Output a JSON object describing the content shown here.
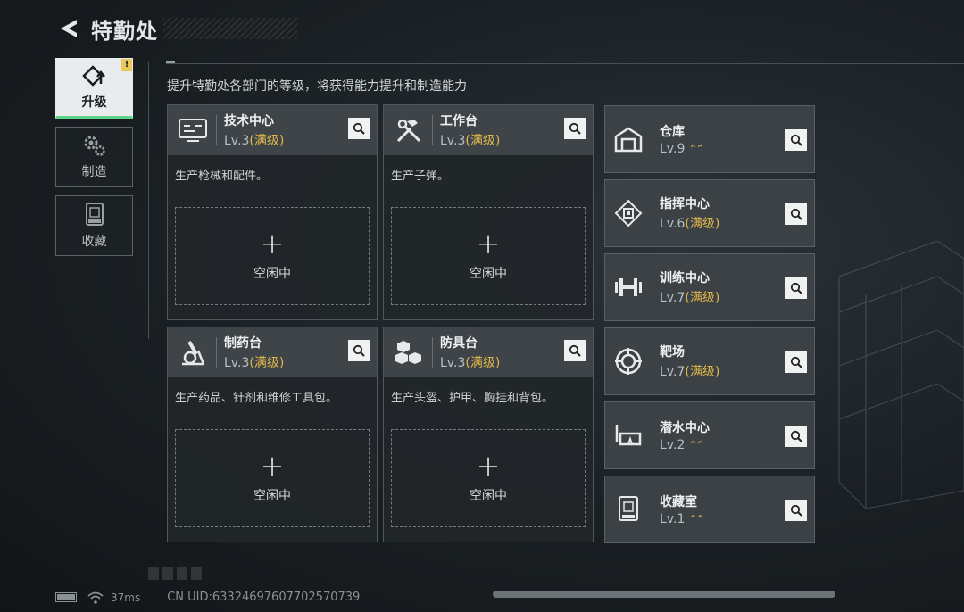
{
  "header": {
    "title": "特勤处"
  },
  "sidenav": [
    {
      "label": "升级",
      "icon": "upgrade-icon",
      "active": true,
      "badge": "!"
    },
    {
      "label": "制造",
      "icon": "gears-icon",
      "active": false
    },
    {
      "label": "收藏",
      "icon": "collection-icon",
      "active": false
    }
  ],
  "description": "提升特勤处各部门的等级，将获得能力提升和制造能力",
  "cards": [
    {
      "name": "技术中心",
      "level": "Lv.3",
      "status": "(满级)",
      "desc": "生产枪械和配件。",
      "slot_label": "空闲中",
      "icon": "computer-icon"
    },
    {
      "name": "工作台",
      "level": "Lv.3",
      "status": "(满级)",
      "desc": "生产子弹。",
      "slot_label": "空闲中",
      "icon": "hammer-wrench-icon"
    },
    {
      "name": "制药台",
      "level": "Lv.3",
      "status": "(满级)",
      "desc": "生产药品、针剂和维修工具包。",
      "slot_label": "空闲中",
      "icon": "microscope-icon"
    },
    {
      "name": "防具台",
      "level": "Lv.3",
      "status": "(满级)",
      "desc": "生产头盔、护甲、胸挂和背包。",
      "slot_label": "空闲中",
      "icon": "boxes-icon"
    }
  ],
  "facilities": [
    {
      "name": "仓库",
      "level": "Lv.9",
      "status": "",
      "upgradable": true,
      "icon": "warehouse-icon"
    },
    {
      "name": "指挥中心",
      "level": "Lv.6",
      "status": "(满级)",
      "upgradable": false,
      "icon": "chip-icon"
    },
    {
      "name": "训练中心",
      "level": "Lv.7",
      "status": "(满级)",
      "upgradable": false,
      "icon": "dumbbell-icon"
    },
    {
      "name": "靶场",
      "level": "Lv.7",
      "status": "(满级)",
      "upgradable": false,
      "icon": "target-icon"
    },
    {
      "name": "潜水中心",
      "level": "Lv.2",
      "status": "",
      "upgradable": true,
      "icon": "diving-mask-icon"
    },
    {
      "name": "收藏室",
      "level": "Lv.1",
      "status": "",
      "upgradable": true,
      "icon": "display-case-icon"
    }
  ],
  "plus_symbol": "+",
  "upgrade_symbol": "⌃⌃",
  "status": {
    "ping": "37ms",
    "uid": "CN UID:6332469760770​2570739"
  },
  "colors": {
    "accent_green": "#5fd38a",
    "max_level_gold": "#e0b64c"
  }
}
